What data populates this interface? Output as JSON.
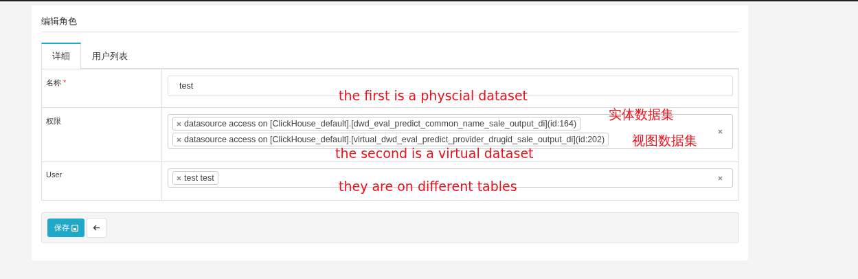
{
  "page": {
    "title": "编辑角色"
  },
  "tabs": [
    {
      "label": "详细",
      "selected": true
    },
    {
      "label": "用户列表",
      "selected": false
    }
  ],
  "form": [
    {
      "kind": "text",
      "label": "名称",
      "required_mark": "*",
      "value": "test"
    },
    {
      "kind": "tags",
      "label": "权限",
      "tags": [
        "datasource access on [ClickHouse_default].[dwd_eval_predict_common_name_sale_output_di](id:164)",
        "datasource access on [ClickHouse_default].[virtual_dwd_eval_predict_provider_drugid_sale_output_di](id:202)"
      ]
    },
    {
      "kind": "tags",
      "label": "User",
      "tags": [
        "test test"
      ]
    }
  ],
  "buttons": [
    {
      "kind": "save",
      "label": "保存"
    },
    {
      "kind": "back"
    }
  ],
  "annotations": [
    {
      "text": "the first is a physcial dataset"
    },
    {
      "text": "实体数据集"
    },
    {
      "text": "视图数据集"
    },
    {
      "text": "the second is a virtual dataset"
    },
    {
      "text": "they are on different tables"
    }
  ]
}
